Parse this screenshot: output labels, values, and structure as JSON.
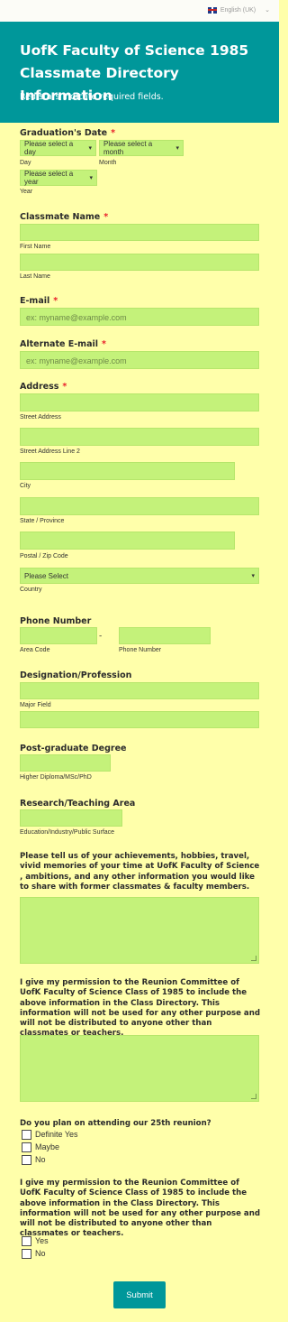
{
  "lang": {
    "label": "English (UK)"
  },
  "header": {
    "title": "UofK Faculty of Science 1985 Classmate Directory Information",
    "subtitle": "Red stars indicate required fields."
  },
  "graduation": {
    "label": "Graduation's Date",
    "day_select": "Please select a day",
    "month_select": "Please select a month",
    "year_select": "Please select a year",
    "day_sub": "Day",
    "month_sub": "Month",
    "year_sub": "Year"
  },
  "name": {
    "label": "Classmate Name",
    "first_sub": "First Name",
    "last_sub": "Last Name"
  },
  "email": {
    "label": "E-mail",
    "placeholder": "ex: myname@example.com"
  },
  "alt_email": {
    "label": "Alternate E-mail",
    "placeholder": "ex: myname@example.com"
  },
  "address": {
    "label": "Address",
    "street_sub": "Street Address",
    "street2_sub": "Street Address Line 2",
    "city_sub": "City",
    "state_sub": "State / Province",
    "zip_sub": "Postal / Zip Code",
    "country_select": "Please Select",
    "country_sub": "Country"
  },
  "phone": {
    "label": "Phone Number",
    "dash": "-",
    "area_sub": "Area Code",
    "number_sub": "Phone Number"
  },
  "designation": {
    "label": "Designation/Profession",
    "major_sub": "Major Field"
  },
  "postgrad": {
    "label": "Post-graduate Degree",
    "sub": "Higher Diploma/MSc/PhD"
  },
  "research": {
    "label": "Research/Teaching Area",
    "sub": "Education/Industry/Public Surface"
  },
  "achievements": {
    "label": "Please tell us of your achievements, hobbies, travel, vivid memories of your time at UofK Faculty of Science , ambitions, and any other information you would like to share with former classmates & faculty members."
  },
  "permission1": {
    "label": "I give my permission to the Reunion Committee of UofK Faculty of Science Class of 1985 to include the above information in the Class Directory. This information will not be used for any other purpose and will not be distributed to anyone other than classmates or teachers."
  },
  "reunion": {
    "label": "Do you plan on attending our 25th reunion?",
    "options": [
      "Definite Yes",
      "Maybe",
      "No"
    ]
  },
  "permission2": {
    "label": "I give my permission to the Reunion Committee of UofK Faculty of Science Class of 1985 to include the above information in the Class Directory. This information will not be used for any other purpose and will not be distributed to anyone other than classmates or teachers.",
    "options": [
      "Yes",
      "No"
    ]
  },
  "submit": {
    "label": "Submit"
  }
}
